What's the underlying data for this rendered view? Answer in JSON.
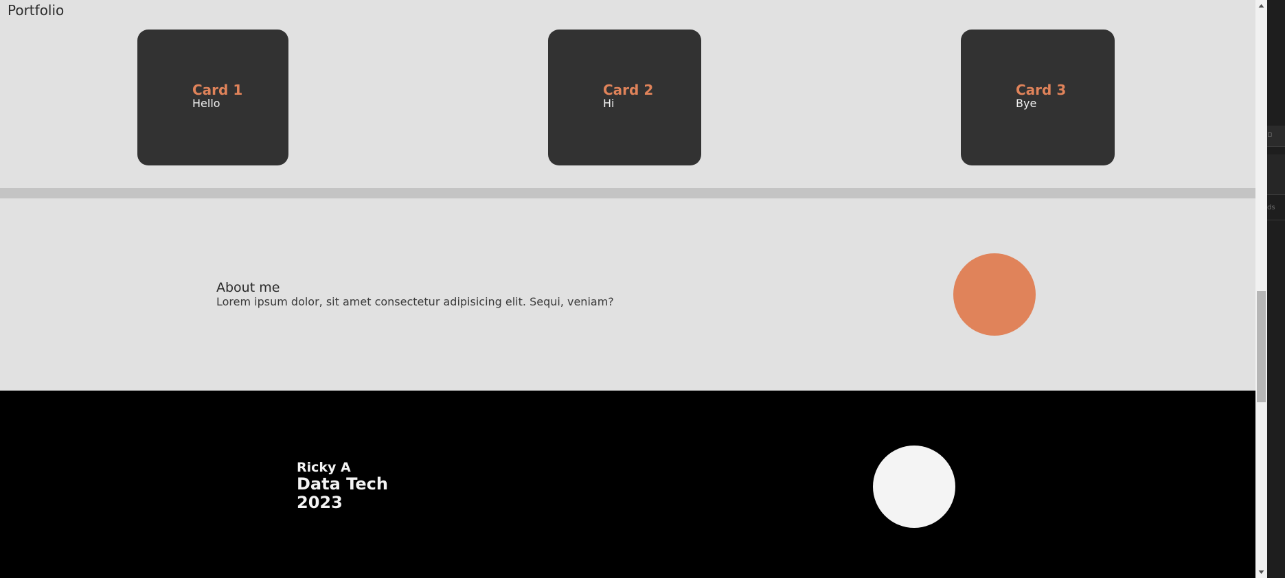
{
  "portfolio": {
    "title": "Portfolio",
    "cards": [
      {
        "title": "Card 1",
        "text": "Hello"
      },
      {
        "title": "Card 2",
        "text": "Hi"
      },
      {
        "title": "Card 3",
        "text": "Bye"
      }
    ]
  },
  "about": {
    "title": "About me",
    "body": "Lorem ipsum dolor, sit amet consectetur adipisicing elit. Sequi, veniam?"
  },
  "footer": {
    "name": "Ricky A",
    "line1": "Data Tech",
    "line2": "2023"
  },
  "side_panel": {
    "tab_glyph": "▫",
    "row_text": "ds"
  },
  "colors": {
    "accent": "#e0835a",
    "card_bg": "#323232",
    "section_bg": "#e1e1e1",
    "footer_bg": "#000000",
    "footer_circle": "#f4f4f4"
  },
  "icons": {
    "scroll_up": "triangle-up",
    "scroll_down": "triangle-down"
  }
}
